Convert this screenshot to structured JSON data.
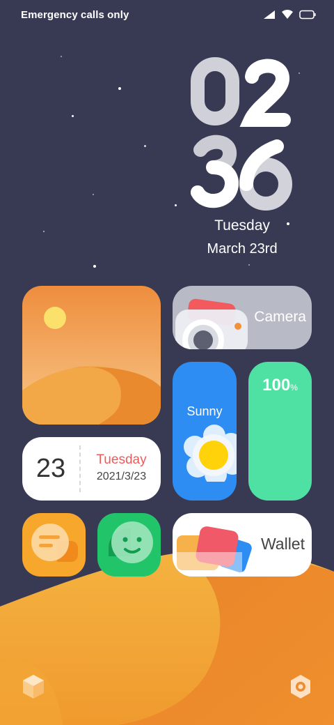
{
  "status_bar": {
    "carrier_text": "Emergency calls only",
    "icons": [
      "signal-icon",
      "wifi-icon",
      "battery-icon"
    ]
  },
  "clock": {
    "hours": "02",
    "minutes": "36"
  },
  "date": {
    "weekday": "Tuesday",
    "full": "March 23rd"
  },
  "widgets": {
    "photo": {
      "icon": "desert-sun-photo"
    },
    "calendar": {
      "day": "23",
      "weekday": "Tuesday",
      "date": "2021/3/23"
    },
    "camera": {
      "label": "Camera"
    },
    "weather": {
      "label": "Sunny"
    },
    "battery": {
      "value": "100",
      "unit": "%"
    },
    "messages": {
      "icon": "message-bubble-icon"
    },
    "chat": {
      "icon": "chat-face-icon"
    },
    "wallet": {
      "label": "Wallet"
    }
  },
  "dock": {
    "left_icon": "cube-icon",
    "right_icon": "settings-gear-icon"
  },
  "colors": {
    "background": "#383a54",
    "weather": "#2d8df2",
    "battery": "#4fe0a3",
    "messages": "#f6a72c",
    "chat": "#22c46a",
    "calendar_accent": "#f05a58",
    "sand": "#f0a23a"
  }
}
